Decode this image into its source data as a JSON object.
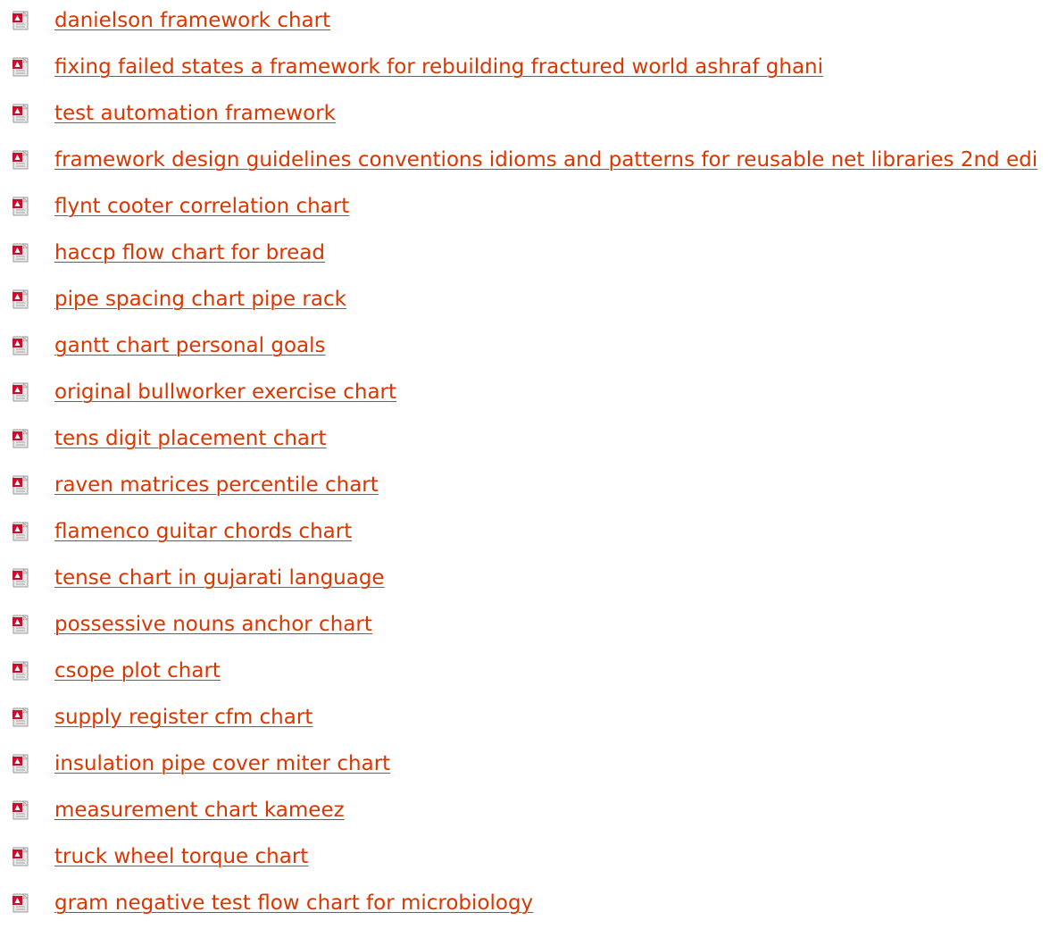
{
  "documents": {
    "icon": "pdf-file-icon",
    "link_color": "#d83700",
    "items": [
      {
        "title": "danielson framework chart"
      },
      {
        "title": "fixing failed states a framework for rebuilding fractured world ashraf ghani"
      },
      {
        "title": "test automation framework"
      },
      {
        "title": "framework design guidelines conventions idioms and patterns for reusable net libraries 2nd edi"
      },
      {
        "title": "flynt cooter correlation chart"
      },
      {
        "title": "haccp flow chart for bread"
      },
      {
        "title": "pipe spacing chart pipe rack"
      },
      {
        "title": "gantt chart personal goals"
      },
      {
        "title": "original bullworker exercise chart"
      },
      {
        "title": "tens digit placement chart"
      },
      {
        "title": "raven matrices percentile chart"
      },
      {
        "title": "flamenco guitar chords chart"
      },
      {
        "title": "tense chart in gujarati language"
      },
      {
        "title": "possessive nouns anchor chart"
      },
      {
        "title": "csope plot chart"
      },
      {
        "title": "supply register cfm chart"
      },
      {
        "title": "insulation pipe cover miter chart"
      },
      {
        "title": "measurement chart kameez"
      },
      {
        "title": "truck wheel torque chart"
      },
      {
        "title": "gram negative test flow chart for microbiology"
      }
    ]
  }
}
